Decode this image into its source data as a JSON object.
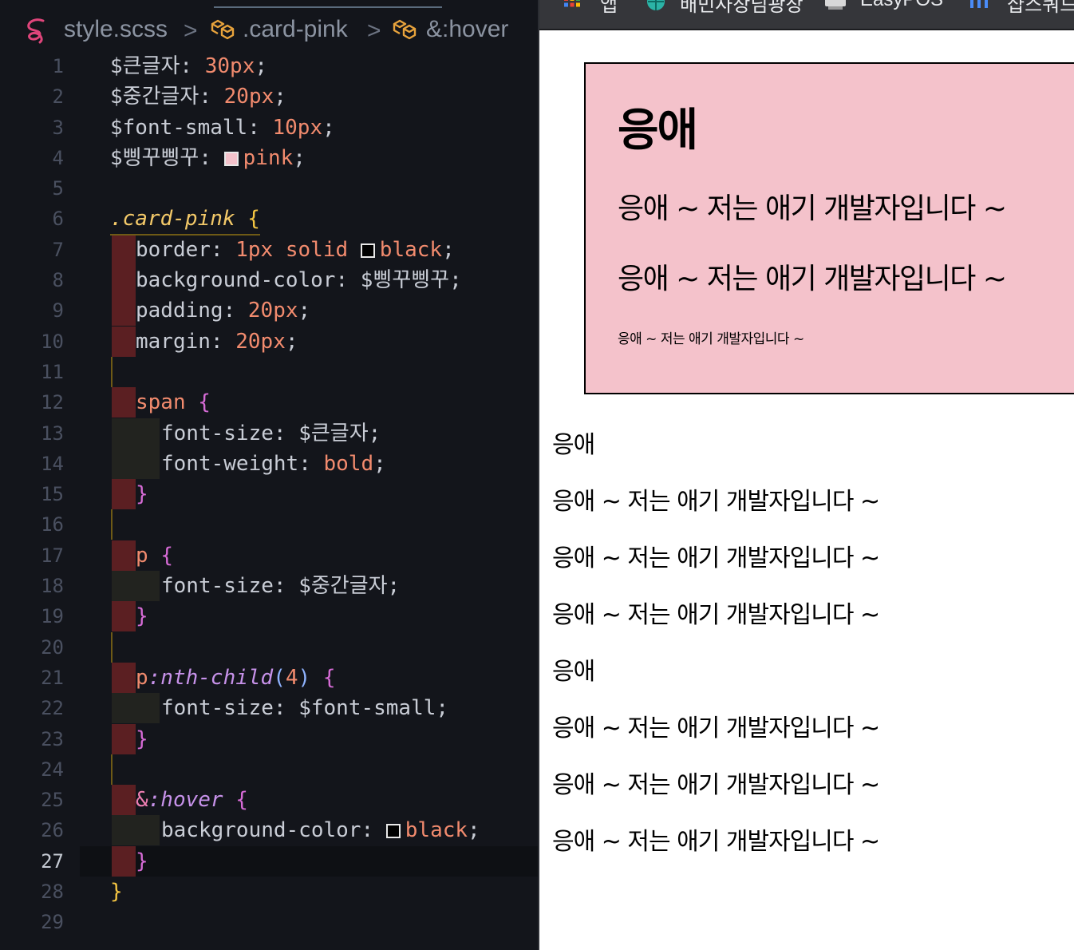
{
  "editor": {
    "breadcrumb": {
      "file": "style.scss",
      "symbol1": ".card-pink",
      "symbol2": "&:hover",
      "separator": ">"
    },
    "active_line": "27",
    "lines": [
      {
        "n": "1",
        "t": "$큰글자: 30px;"
      },
      {
        "n": "2",
        "t": "$중간글자: 20px;"
      },
      {
        "n": "3",
        "t": "$font-small: 10px;"
      },
      {
        "n": "4",
        "t": "$삥꾸삥꾸: pink;"
      },
      {
        "n": "5",
        "t": ""
      },
      {
        "n": "6",
        "t": ".card-pink {"
      },
      {
        "n": "7",
        "t": "border: 1px solid black;"
      },
      {
        "n": "8",
        "t": "background-color: $삥꾸삥꾸;"
      },
      {
        "n": "9",
        "t": "padding: 20px;"
      },
      {
        "n": "10",
        "t": "margin: 20px;"
      },
      {
        "n": "11",
        "t": ""
      },
      {
        "n": "12",
        "t": "span {"
      },
      {
        "n": "13",
        "t": "font-size: $큰글자;"
      },
      {
        "n": "14",
        "t": "font-weight: bold;"
      },
      {
        "n": "15",
        "t": "}"
      },
      {
        "n": "16",
        "t": ""
      },
      {
        "n": "17",
        "t": "p {"
      },
      {
        "n": "18",
        "t": "font-size: $중간글자;"
      },
      {
        "n": "19",
        "t": "}"
      },
      {
        "n": "20",
        "t": ""
      },
      {
        "n": "21",
        "t": "p:nth-child(4) {"
      },
      {
        "n": "22",
        "t": "font-size: $font-small;"
      },
      {
        "n": "23",
        "t": "}"
      },
      {
        "n": "24",
        "t": ""
      },
      {
        "n": "25",
        "t": "&:hover {"
      },
      {
        "n": "26",
        "t": "background-color: black;"
      },
      {
        "n": "27",
        "t": "}"
      },
      {
        "n": "28",
        "t": "}"
      },
      {
        "n": "29",
        "t": ""
      }
    ],
    "tokens": {
      "v_big": "$큰글자",
      "v_mid": "$중간글자",
      "v_small": "$font-small",
      "v_pink": "$삥꾸삥꾸",
      "n30": "30px",
      "n20": "20px",
      "n10": "10px",
      "n1": "1px",
      "pink": "pink",
      "black": "black",
      "solid": "solid",
      "bold": "bold",
      "card_class": ".card-pink",
      "p_border": "border",
      "p_bg": "background-color",
      "p_padding": "padding",
      "p_margin": "margin",
      "p_fs": "font-size",
      "p_fw": "font-weight",
      "span": "span",
      "p": "p",
      "nth": ":nth-child",
      "four": "4",
      "amp": "&",
      "hover": ":hover"
    },
    "colors": {
      "background": "#13151b",
      "accent_number": "#f28b6e",
      "accent_class": "#f3c969",
      "accent_pseudo": "#c792ea",
      "indent_rainbow_red": "#5b1f22",
      "swatch_pink": "#f4c2cb",
      "swatch_black": "#000000"
    }
  },
  "browser": {
    "bookmarks": [
      {
        "icon": "apps-grid-icon",
        "label": "앱"
      },
      {
        "icon": "globe-icon",
        "label": "배민사장님광장"
      },
      {
        "icon": "printer-icon",
        "label": "EasyPOS"
      },
      {
        "icon": "bar-chart-icon",
        "label": "샵스쿼드"
      }
    ],
    "card": {
      "title": "응애",
      "p1": "응애 ~ 저는 애기 개발자입니다 ~",
      "p2": "응애 ~ 저는 애기 개발자입니다 ~",
      "small": "응애 ~ 저는 애기 개발자입니다 ~",
      "background": "#f4c2cb"
    },
    "plain": [
      "응애",
      "응애 ~ 저는 애기 개발자입니다 ~",
      "응애 ~ 저는 애기 개발자입니다 ~",
      "응애 ~ 저는 애기 개발자입니다 ~",
      "응애",
      "응애 ~ 저는 애기 개발자입니다 ~",
      "응애 ~ 저는 애기 개발자입니다 ~",
      "응애 ~ 저는 애기 개발자입니다 ~"
    ]
  }
}
